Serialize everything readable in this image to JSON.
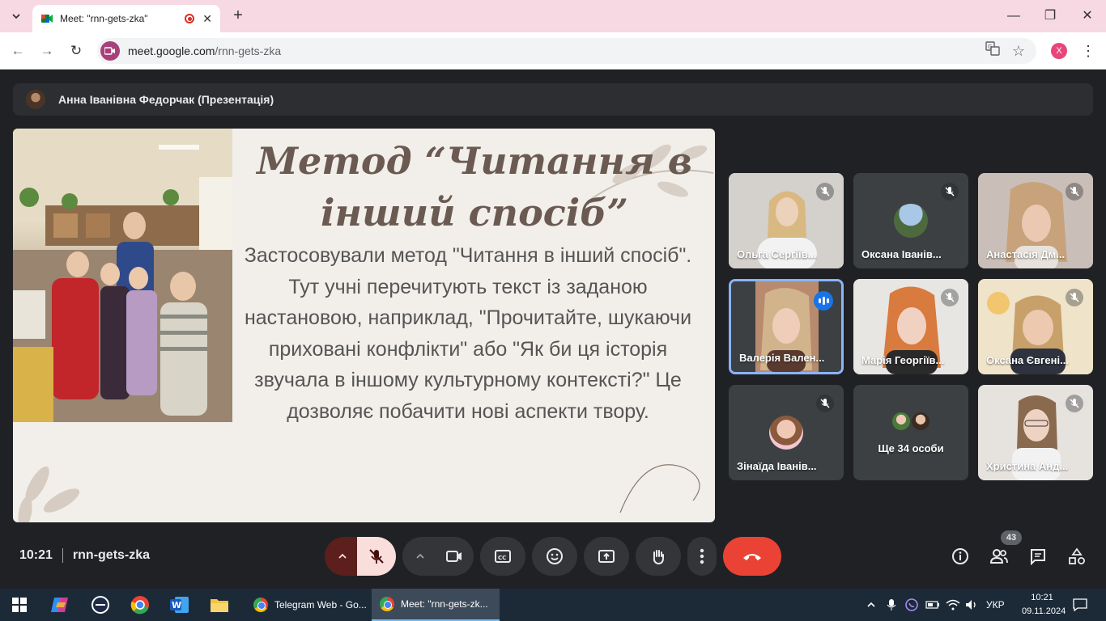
{
  "browser": {
    "tab_title": "Meet: \"rnn-gets-zka\"",
    "url_host": "meet.google.com",
    "url_path": "/rnn-gets-zka",
    "profile_initial": "X"
  },
  "meet": {
    "presenter_name": "Анна Іванівна Федорчак (Презентація)",
    "slide": {
      "title": "Метод “Читання в інший спосіб”",
      "body": "Застосовували  метод \"Читання в інший спосіб\". Тут учні перечитують текст із заданою настановою, наприклад, \"Прочитайте, шукаючи приховані конфлікти\" або \"Як би ця історія звучала в іншому культурному контексті?\" Це дозволяє побачити нові аспекти твору."
    },
    "participants": [
      {
        "name": "Ольга Сергіїв..."
      },
      {
        "name": "Оксана Іванів..."
      },
      {
        "name": "Анастасія Дм..."
      },
      {
        "name": "Валерія Вален..."
      },
      {
        "name": "Марія Георгіїв..."
      },
      {
        "name": "Оксана Євгені..."
      },
      {
        "name": "Зінаїда Іванів..."
      },
      {
        "name": "Ще 34 особи"
      },
      {
        "name": "Христина Анд..."
      }
    ],
    "time": "10:21",
    "meeting_code": "rnn-gets-zka",
    "people_count": "43"
  },
  "taskbar": {
    "apps": [
      {
        "label": "Telegram Web - Go..."
      },
      {
        "label": "Meet: \"rnn-gets-zk..."
      }
    ],
    "language": "УКР",
    "time": "10:21",
    "date": "09.11.2024"
  },
  "colors": {
    "meet_bg": "#202124",
    "end_call": "#ea4335",
    "active_speaker": "#8ab4f8",
    "tab_strip": "#f6d9e3"
  }
}
